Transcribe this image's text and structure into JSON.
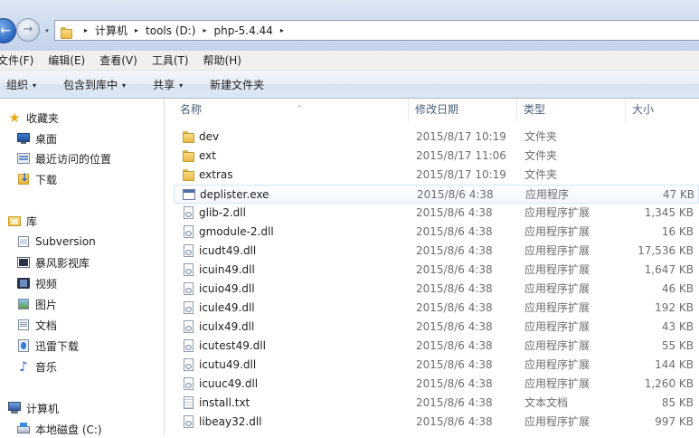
{
  "address": {
    "nav_back": "←",
    "nav_forward": "→",
    "path": [
      "计算机",
      "tools (D:)",
      "php-5.4.44"
    ],
    "separator": "▸"
  },
  "menu": [
    "文件(F)",
    "编辑(E)",
    "查看(V)",
    "工具(T)",
    "帮助(H)"
  ],
  "commands": {
    "organize": "组织",
    "include_in_library": "包含到库中",
    "share": "共享",
    "new_folder": "新建文件夹",
    "caret": "▾"
  },
  "nav": {
    "favorites": {
      "title": "收藏夹",
      "items": [
        "桌面",
        "最近访问的位置",
        "下载"
      ]
    },
    "libraries": {
      "title": "库",
      "items": [
        "Subversion",
        "暴风影视库",
        "视频",
        "图片",
        "文档",
        "迅雷下载",
        "音乐"
      ]
    },
    "computer": {
      "title": "计算机",
      "items": [
        "本地磁盘 (C:)"
      ]
    }
  },
  "columns": {
    "name": "名称",
    "modified": "修改日期",
    "type": "类型",
    "size": "大小",
    "sort_indicator": "^"
  },
  "files": [
    {
      "name": "dev",
      "date": "2015/8/17 10:19",
      "type": "文件夹",
      "size": "",
      "icon": "folder-icon"
    },
    {
      "name": "ext",
      "date": "2015/8/17 11:06",
      "type": "文件夹",
      "size": "",
      "icon": "folder-icon"
    },
    {
      "name": "extras",
      "date": "2015/8/17 10:19",
      "type": "文件夹",
      "size": "",
      "icon": "folder-icon"
    },
    {
      "name": "deplister.exe",
      "date": "2015/8/6 4:38",
      "type": "应用程序",
      "size": "47 KB",
      "icon": "exe-icon"
    },
    {
      "name": "glib-2.dll",
      "date": "2015/8/6 4:38",
      "type": "应用程序扩展",
      "size": "1,345 KB",
      "icon": "dll-icon"
    },
    {
      "name": "gmodule-2.dll",
      "date": "2015/8/6 4:38",
      "type": "应用程序扩展",
      "size": "16 KB",
      "icon": "dll-icon"
    },
    {
      "name": "icudt49.dll",
      "date": "2015/8/6 4:38",
      "type": "应用程序扩展",
      "size": "17,536 KB",
      "icon": "dll-icon"
    },
    {
      "name": "icuin49.dll",
      "date": "2015/8/6 4:38",
      "type": "应用程序扩展",
      "size": "1,647 KB",
      "icon": "dll-icon"
    },
    {
      "name": "icuio49.dll",
      "date": "2015/8/6 4:38",
      "type": "应用程序扩展",
      "size": "46 KB",
      "icon": "dll-icon"
    },
    {
      "name": "icule49.dll",
      "date": "2015/8/6 4:38",
      "type": "应用程序扩展",
      "size": "192 KB",
      "icon": "dll-icon"
    },
    {
      "name": "iculx49.dll",
      "date": "2015/8/6 4:38",
      "type": "应用程序扩展",
      "size": "43 KB",
      "icon": "dll-icon"
    },
    {
      "name": "icutest49.dll",
      "date": "2015/8/6 4:38",
      "type": "应用程序扩展",
      "size": "55 KB",
      "icon": "dll-icon"
    },
    {
      "name": "icutu49.dll",
      "date": "2015/8/6 4:38",
      "type": "应用程序扩展",
      "size": "144 KB",
      "icon": "dll-icon"
    },
    {
      "name": "icuuc49.dll",
      "date": "2015/8/6 4:38",
      "type": "应用程序扩展",
      "size": "1,260 KB",
      "icon": "dll-icon"
    },
    {
      "name": "install.txt",
      "date": "2015/8/6 4:38",
      "type": "文本文档",
      "size": "85 KB",
      "icon": "txt-icon"
    },
    {
      "name": "libeay32.dll",
      "date": "2015/8/6 4:38",
      "type": "应用程序扩展",
      "size": "997 KB",
      "icon": "dll-icon"
    }
  ]
}
